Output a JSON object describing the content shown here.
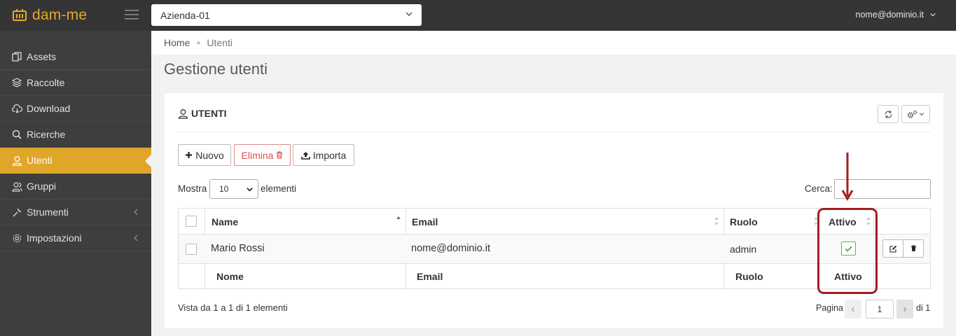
{
  "app": {
    "name": "dam-me",
    "company": "Azienda-01",
    "user": "nome@dominio.it"
  },
  "colors": {
    "accent": "#dfa629",
    "sidebar": "#3e3e3e",
    "topbar": "#353535",
    "danger": "#d9534f",
    "success": "#6ab04c",
    "annotation": "#a01e22"
  },
  "sidebar": {
    "items": [
      {
        "label": "Assets",
        "icon": "copy-icon"
      },
      {
        "label": "Raccolte",
        "icon": "layers-icon"
      },
      {
        "label": "Download",
        "icon": "cloud-download-icon"
      },
      {
        "label": "Ricerche",
        "icon": "search-icon"
      },
      {
        "label": "Utenti",
        "icon": "user-icon",
        "active": true
      },
      {
        "label": "Gruppi",
        "icon": "users-icon"
      },
      {
        "label": "Strumenti",
        "icon": "wrench-icon",
        "submenu": true
      },
      {
        "label": "Impostazioni",
        "icon": "gear-icon",
        "submenu": true
      }
    ]
  },
  "breadcrumb": {
    "home": "Home",
    "current": "Utenti"
  },
  "page": {
    "title": "Gestione utenti"
  },
  "card": {
    "title": "UTENTI"
  },
  "toolbar": {
    "new": "Nuovo",
    "delete": "Elimina",
    "import": "Importa"
  },
  "length": {
    "prefix": "Mostra",
    "value": "10",
    "suffix": "elementi"
  },
  "search": {
    "label": "Cerca:",
    "value": ""
  },
  "table": {
    "headers": {
      "name": "Name",
      "email": "Email",
      "role": "Ruolo",
      "active": "Attivo"
    },
    "rows": [
      {
        "name": "Mario Rossi",
        "email": "nome@dominio.it",
        "role": "admin",
        "active": true
      }
    ],
    "footers": {
      "name": "Nome",
      "email": "Email",
      "role": "Ruolo",
      "active": "Attivo"
    }
  },
  "info": "Vista da 1 a 1 di 1 elementi",
  "pagination": {
    "label": "Pagina",
    "page": "1",
    "total": "di 1"
  }
}
